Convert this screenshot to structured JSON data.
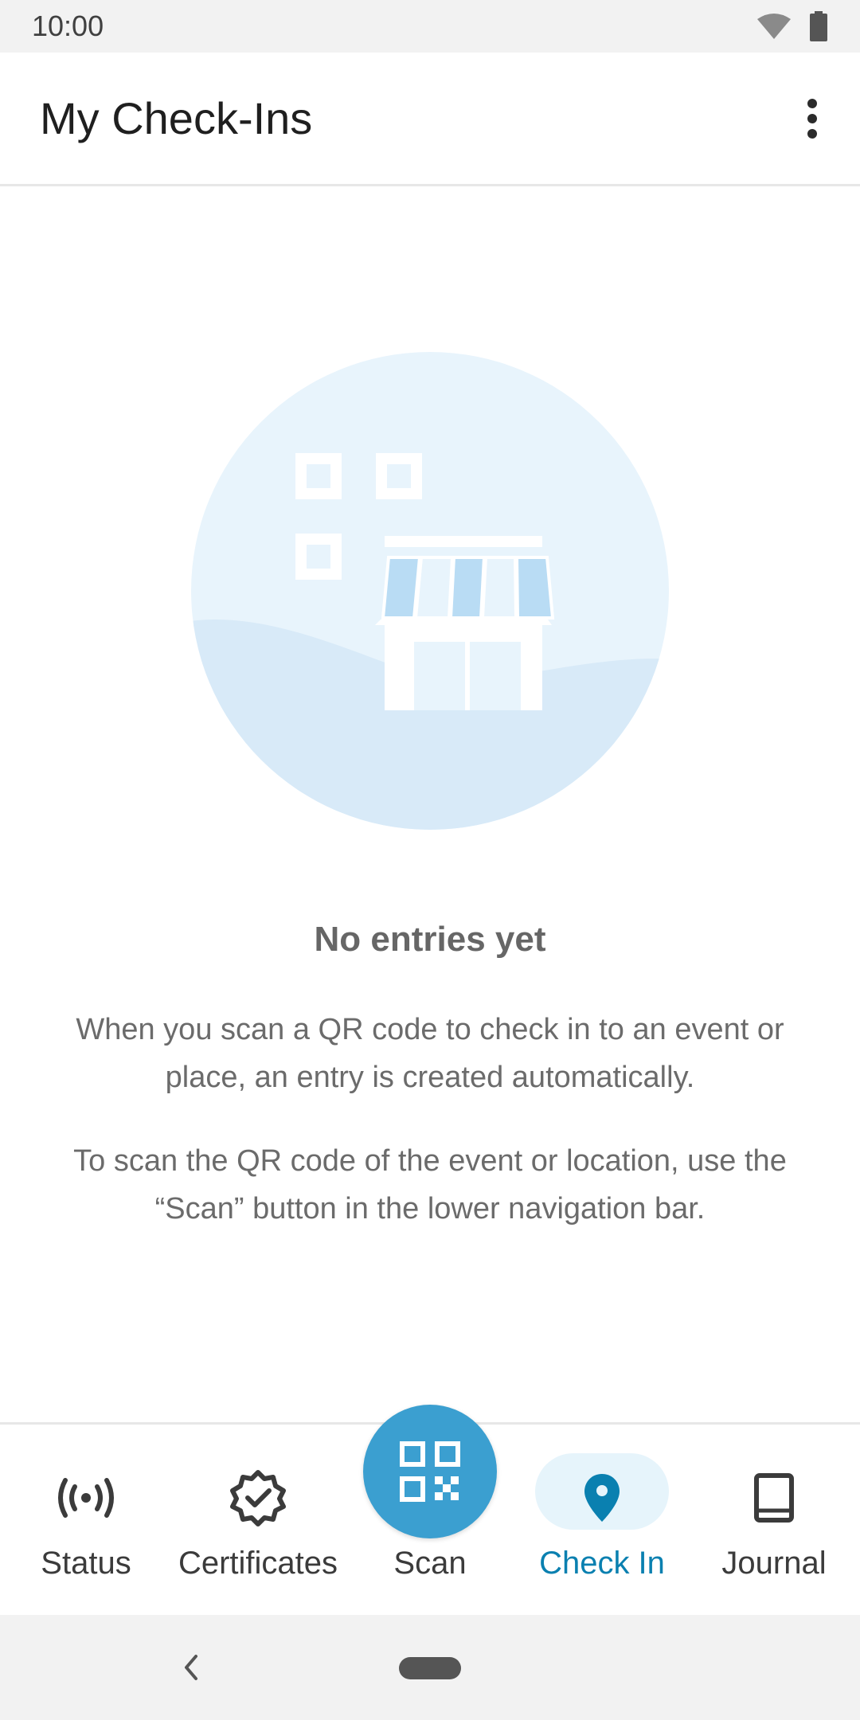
{
  "status_bar": {
    "time": "10:00"
  },
  "app_bar": {
    "title": "My Check-Ins",
    "menu_icon": "more-vert-icon"
  },
  "empty_state": {
    "illustration": "store-qr-illustration",
    "title": "No entries yet",
    "text_1": "When you scan a QR code to check in to an event or place, an entry is created automatically.",
    "text_2": "To scan the QR code of the event or location, use the “Scan” button in the lower navigation bar."
  },
  "bottom_nav": {
    "items": [
      {
        "label": "Status",
        "icon": "broadcast-icon",
        "active": false
      },
      {
        "label": "Certificates",
        "icon": "verified-badge-icon",
        "active": false
      },
      {
        "label": "Scan",
        "icon": "qr-code-icon",
        "active": false
      },
      {
        "label": "Check In",
        "icon": "location-pin-icon",
        "active": true
      },
      {
        "label": "Journal",
        "icon": "book-icon",
        "active": false
      }
    ]
  },
  "colors": {
    "accent": "#0a80b0",
    "fab": "#3b9fd0",
    "active_pill": "#e6f4fb",
    "illustration_bg": "#e8f4fc"
  }
}
